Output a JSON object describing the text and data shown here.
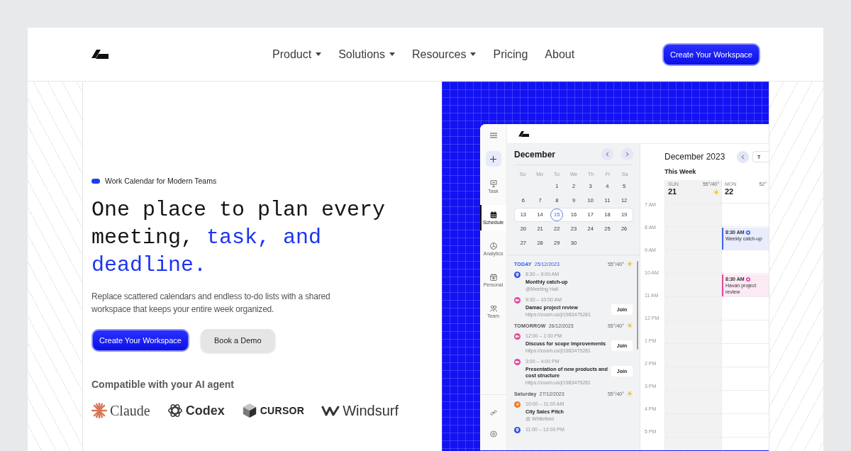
{
  "nav": {
    "links": [
      {
        "label": "Product",
        "dropdown": true
      },
      {
        "label": "Solutions",
        "dropdown": true
      },
      {
        "label": "Resources",
        "dropdown": true
      },
      {
        "label": "Pricing",
        "dropdown": false
      },
      {
        "label": "About",
        "dropdown": false
      }
    ],
    "cta": "Create Your Workspace"
  },
  "hero": {
    "tag": "Work Calendar for Modern Teams",
    "heading": {
      "lead": "One place to plan every meeting,",
      "highlight": "task, and deadline."
    },
    "description": "Replace scattered calendars and endless to-do lists with a shared workspace that keeps your entire week organized.",
    "buttons": [
      {
        "label": "Create Your Workspace",
        "kind": "primary"
      },
      {
        "label": "Book a Demo",
        "kind": "secondary"
      }
    ],
    "compat_title": "Compatible with your AI agent",
    "agents": [
      {
        "name": "Claude",
        "kind": "asterisk"
      },
      {
        "name": "Codex",
        "kind": "atom"
      },
      {
        "name": "CURSOR",
        "kind": "cube"
      },
      {
        "name": "Windsurf",
        "kind": "zigzag"
      }
    ]
  },
  "app": {
    "sidebar": {
      "items": [
        {
          "label": "Task",
          "kind": "board",
          "selected": false
        },
        {
          "label": "Schedule",
          "kind": "calendar",
          "selected": true
        },
        {
          "label": "Analytics",
          "kind": "pie",
          "selected": false
        },
        {
          "label": "Personal",
          "kind": "calendar-outline",
          "selected": false
        },
        {
          "label": "Team",
          "kind": "people",
          "selected": false
        }
      ]
    },
    "mini_calendar": {
      "month": "December",
      "weekdays": [
        "Su",
        "Mo",
        "Tu",
        "We",
        "Th",
        "Fr",
        "Sa"
      ],
      "weeks": [
        {
          "selected": false,
          "days": [
            {
              "kind": "blank"
            },
            {
              "kind": "blank"
            },
            {
              "kind": "day",
              "label": "1",
              "selected": false
            },
            {
              "kind": "day",
              "label": "2",
              "selected": false
            },
            {
              "kind": "day",
              "label": "3",
              "selected": false
            },
            {
              "kind": "day",
              "label": "4",
              "selected": false
            },
            {
              "kind": "day",
              "label": "5",
              "selected": false
            }
          ]
        },
        {
          "selected": false,
          "days": [
            {
              "kind": "day",
              "label": "6",
              "selected": false
            },
            {
              "kind": "day",
              "label": "7",
              "selected": false
            },
            {
              "kind": "day",
              "label": "8",
              "selected": false
            },
            {
              "kind": "day",
              "label": "9",
              "selected": false
            },
            {
              "kind": "day",
              "label": "10",
              "selected": false
            },
            {
              "kind": "day",
              "label": "11",
              "selected": false
            },
            {
              "kind": "day",
              "label": "12",
              "selected": false
            }
          ]
        },
        {
          "selected": true,
          "days": [
            {
              "kind": "day",
              "label": "13",
              "selected": false
            },
            {
              "kind": "day",
              "label": "14",
              "selected": false
            },
            {
              "kind": "day",
              "label": "15",
              "selected": true
            },
            {
              "kind": "day",
              "label": "16",
              "selected": false
            },
            {
              "kind": "day",
              "label": "17",
              "selected": false
            },
            {
              "kind": "day",
              "label": "18",
              "selected": false
            },
            {
              "kind": "day",
              "label": "19",
              "selected": false
            }
          ]
        },
        {
          "selected": false,
          "days": [
            {
              "kind": "day",
              "label": "20",
              "selected": false
            },
            {
              "kind": "day",
              "label": "21",
              "selected": false
            },
            {
              "kind": "day",
              "label": "22",
              "selected": false
            },
            {
              "kind": "day",
              "label": "23",
              "selected": false
            },
            {
              "kind": "day",
              "label": "24",
              "selected": false
            },
            {
              "kind": "day",
              "label": "25",
              "selected": false
            },
            {
              "kind": "day",
              "label": "26",
              "selected": false
            }
          ]
        },
        {
          "selected": false,
          "days": [
            {
              "kind": "day",
              "label": "27",
              "selected": false
            },
            {
              "kind": "day",
              "label": "28",
              "selected": false
            },
            {
              "kind": "day",
              "label": "29",
              "selected": false
            },
            {
              "kind": "day",
              "label": "30",
              "selected": false
            }
          ]
        }
      ]
    },
    "agenda": [
      {
        "label": "TODAY",
        "date": "25/12/2023",
        "today": true,
        "weather": "55°/40°",
        "sunny": true,
        "events": [
          {
            "kind": "pin",
            "color": "#3552dc",
            "time": "8:30 – 9:00 AM",
            "title": "Monthly catch-up",
            "detail": "@Meeting Hall"
          },
          {
            "kind": "video",
            "color": "#e2489c",
            "time": "9:30 – 10:00 AM",
            "title": "Damac project review",
            "detail": "https://zoom.us/j/1983475281",
            "action": "Join"
          }
        ]
      },
      {
        "label": "TOMORROW",
        "date": "26/12/2023",
        "today": false,
        "weather": "55°/40°",
        "sunny": true,
        "events": [
          {
            "kind": "video",
            "color": "#e2489c",
            "time": "12:00 – 1:00 PM",
            "title": "Discuss for scope improvements",
            "detail": "https://zoom.us/j/1983475281",
            "action": "Join"
          },
          {
            "kind": "video",
            "color": "#e2489c",
            "time": "3:00 – 4:00 PM",
            "title": "Presentation of new products and cost structure",
            "detail": "https://zoom.us/j/1983475281",
            "action": "Join"
          }
        ]
      },
      {
        "label": "Saturday",
        "date": "27/12/2023",
        "today": false,
        "weather": "55°/40°",
        "sunny": true,
        "events": [
          {
            "kind": "arrow",
            "color": "#f07a2c",
            "time": "10:00 – 11:00 AM",
            "title": "City Sales Pitch",
            "detail": "@ Whitefield"
          },
          {
            "kind": "pin",
            "color": "#3552dc",
            "time": "11:00 – 12:00 PM"
          }
        ]
      }
    ],
    "week_view": {
      "title": "December 2023",
      "today_button": "T",
      "subtitle": "This Week",
      "days": [
        {
          "weekday": "SUN",
          "date": "21",
          "weather": "55°/40°",
          "sunny": true,
          "shaded": true
        },
        {
          "weekday": "MON",
          "date": "22",
          "weather": "52°",
          "sunny": false,
          "shaded": false
        }
      ],
      "rows": [
        {
          "time": "7 AM"
        },
        {
          "time": "8 AM",
          "cells": [
            {
              "kind": "empty"
            },
            {
              "kind": "event",
              "time": "8:30 AM",
              "title": "Weekly catch-up",
              "color": "#3f63e6"
            }
          ]
        },
        {
          "time": "9 AM"
        },
        {
          "time": "10 AM",
          "cells": [
            {
              "kind": "empty"
            },
            {
              "kind": "event",
              "time": "8:30 AM",
              "title": "Havan project review",
              "color": "#e2489c"
            }
          ]
        },
        {
          "time": "11 AM"
        },
        {
          "time": "12 PM"
        },
        {
          "time": "1 PM"
        },
        {
          "time": "2 PM"
        },
        {
          "time": "3 PM"
        },
        {
          "time": "4 PM"
        },
        {
          "time": "5 PM"
        }
      ]
    }
  }
}
